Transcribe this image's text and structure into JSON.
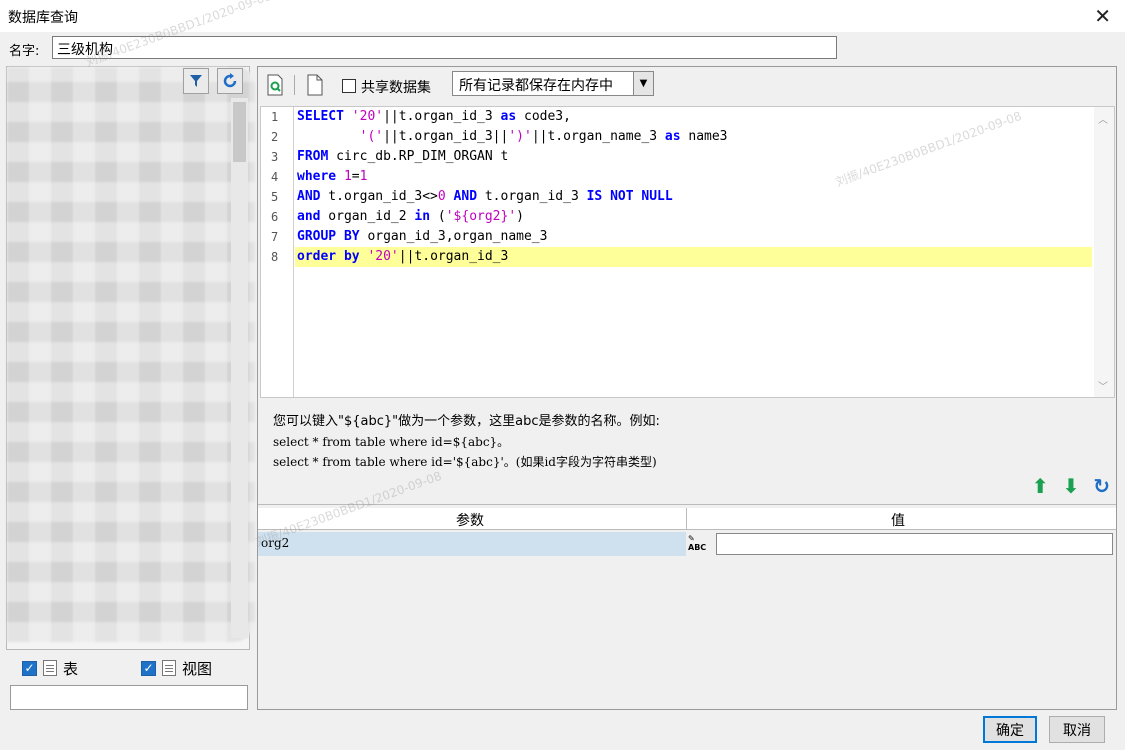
{
  "window": {
    "title": "数据库查询"
  },
  "name_field": {
    "label": "名字:",
    "value": "三级机构"
  },
  "left_panel": {
    "checkboxes": [
      {
        "label": "表",
        "checked": true
      },
      {
        "label": "视图",
        "checked": true
      }
    ]
  },
  "toolbar": {
    "share_label": "共享数据集",
    "storage_mode": "所有记录都保存在内存中"
  },
  "editor": {
    "line_numbers": [
      "1",
      "2",
      "3",
      "4",
      "5",
      "6",
      "7",
      "8"
    ]
  },
  "hint": {
    "line1": "您可以键入\"${abc}\"做为一个参数，这里abc是参数的名称。例如:",
    "line2": "select * from table where id=${abc}。",
    "line3": "select * from table where id='${abc}'。(如果id字段为字符串类型)"
  },
  "params": {
    "col_param": "参数",
    "col_value": "值",
    "rows": [
      {
        "name": "org2",
        "type_icon": "ABC",
        "value": ""
      }
    ]
  },
  "buttons": {
    "ok": "确定",
    "cancel": "取消"
  },
  "watermark": "刘振/40E230B0BBD1/2020-09-08"
}
